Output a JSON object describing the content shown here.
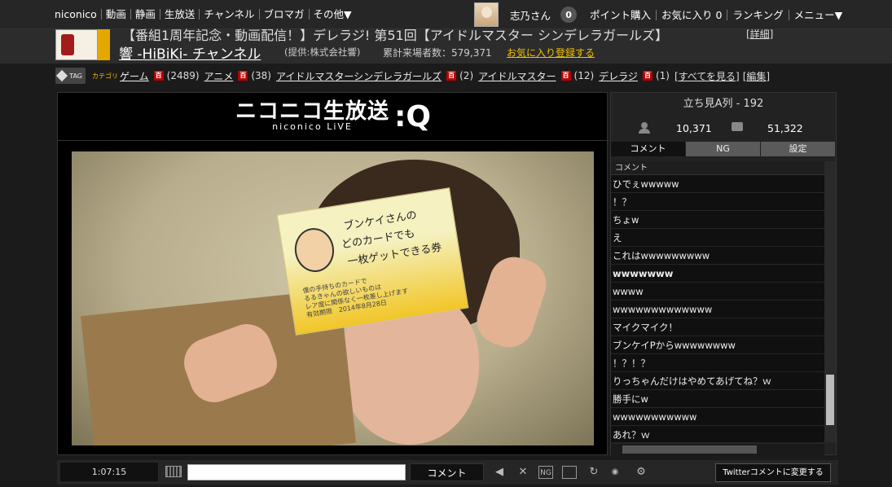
{
  "topnav": {
    "items": [
      "niconico",
      "動画",
      "静画",
      "生放送",
      "チャンネル",
      "ブロマガ",
      "その他▼"
    ],
    "user_name": "志乃さん",
    "point_badge": "0",
    "right_items": [
      "ポイント購入",
      "お気に入り 0",
      "ランキング",
      "メニュー▼"
    ]
  },
  "program": {
    "title": "【番組1周年記念・動画配信！】デレラジ! 第51回【アイドルマスター シンデレラガールズ】",
    "detail_link": "[詳細]",
    "channel_name": "響 -HiBiKi- チャンネル",
    "provider": "(提供:株式会社響)",
    "visitors": "累計来場者数：579,371",
    "favorite_link": "お気に入り登録する"
  },
  "tags": {
    "icon_label": "TAG",
    "category_label": "カテゴリ",
    "dic_label": "百",
    "items": [
      {
        "name": "ゲーム",
        "count": "(2489)"
      },
      {
        "name": "アニメ",
        "count": "(38)"
      },
      {
        "name": "アイドルマスターシンデレラガールズ",
        "count": "(2)"
      },
      {
        "name": "アイドルマスター",
        "count": "(12)"
      },
      {
        "name": "デレラジ",
        "count": "(1)"
      }
    ],
    "show_all": "[すべてを見る]",
    "edit": "[編集]"
  },
  "player": {
    "logo_main": "ニコニコ生放送",
    "logo_sub": "niconico LiVE",
    "logo_q": ":Q",
    "card_lines": [
      "ブンケイさんの",
      "どのカードでも",
      "一枚ゲットできる券"
    ],
    "card_small": [
      "僕の手持ちのカードで",
      "るるきゃんの欲しいものは",
      "レア度に関係なく一枚差し上げます",
      "有効期限　2014年8月28日"
    ]
  },
  "sidebar": {
    "room": "立ち見A列 - 192",
    "viewers": "10,371",
    "comments": "51,322",
    "tabs": [
      "コメント",
      "NG",
      "設定"
    ],
    "comment_header": "コメント",
    "comments_list": [
      "ひでぇwwwww",
      "！？",
      "ちょw",
      "え",
      "これはwwwwwwwww",
      "wwwwwww",
      "wwww",
      "wwwwwwwwwwwww",
      "マイクマイク！",
      "ブンケイPからwwwwwwww",
      "！？！？",
      "りっちゃんだけはやめてあげてね？ｗ",
      "勝手にw",
      "wwwwwwwwwww",
      "あれ？ｗ"
    ]
  },
  "controls": {
    "time": "1:07:15",
    "comment_button": "コメント",
    "twitter_button": "Twitterコメントに変更する"
  }
}
